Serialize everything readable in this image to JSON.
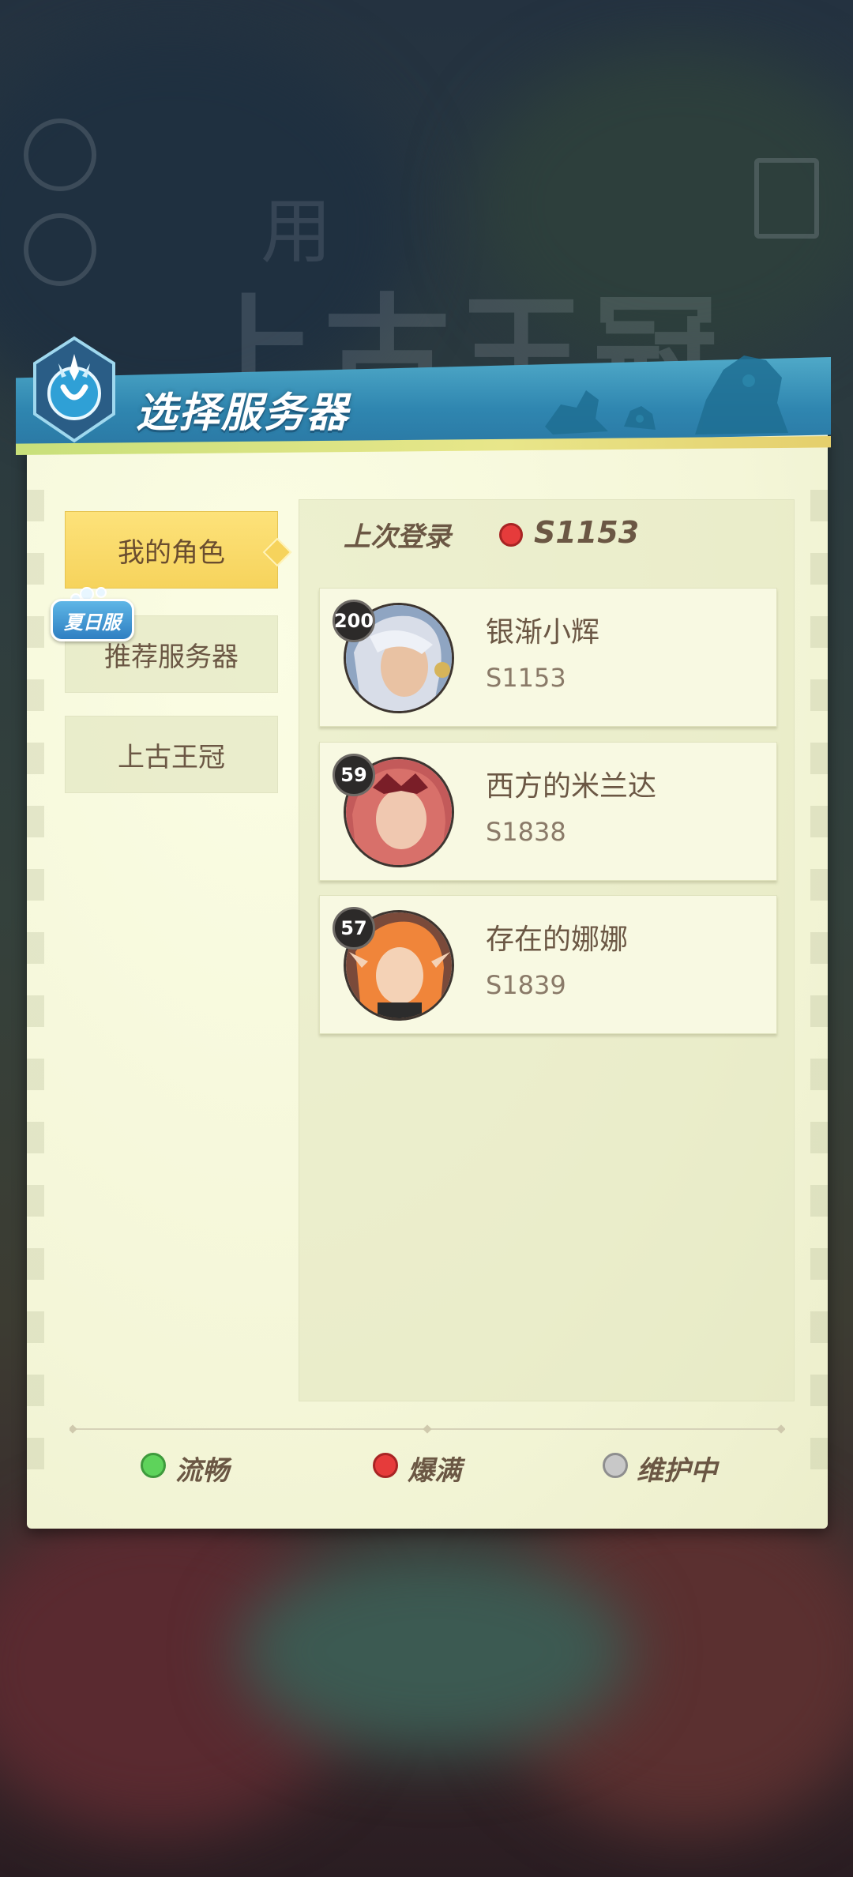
{
  "header": {
    "title": "选择服务器",
    "emblem_icon": "crest-icon"
  },
  "sidebar": {
    "items": [
      {
        "label": "我的角色",
        "active": true
      },
      {
        "label": "推荐服务器",
        "active": false
      },
      {
        "label": "上古王冠",
        "active": false
      }
    ],
    "tag": "夏日服"
  },
  "last_login": {
    "label": "上次登录",
    "server": "S1153",
    "status_color": "#e63b3b"
  },
  "characters": [
    {
      "level": "200",
      "name": "银渐小辉",
      "server": "S1153"
    },
    {
      "level": "59",
      "name": "西方的米兰达",
      "server": "S1838"
    },
    {
      "level": "57",
      "name": "存在的娜娜",
      "server": "S1839"
    }
  ],
  "legend": [
    {
      "label": "流畅",
      "color": "#5ed35b"
    },
    {
      "label": "爆满",
      "color": "#e63b3b"
    },
    {
      "label": "维护中",
      "color": "#c8c8c8"
    }
  ],
  "colors": {
    "accent": "#2f86b0",
    "active_tab": "#f6d35c",
    "text": "#6b5744"
  }
}
